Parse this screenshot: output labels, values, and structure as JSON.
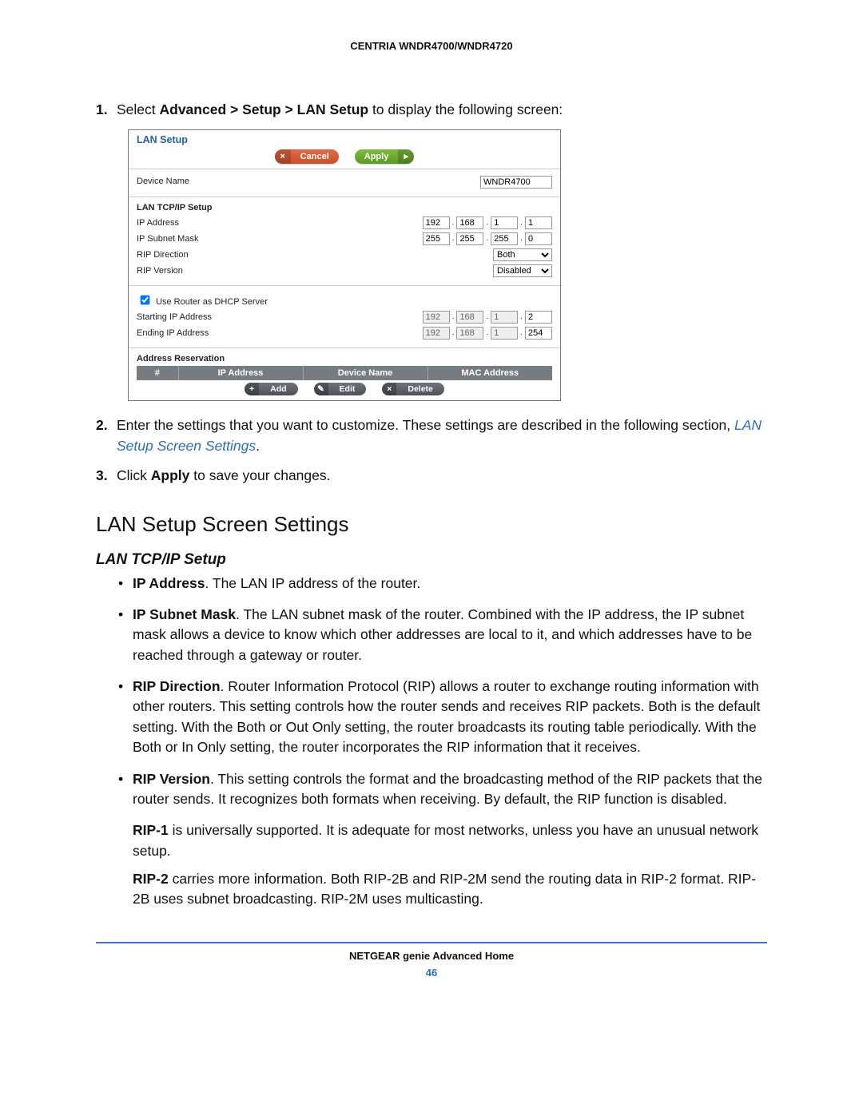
{
  "doc_header": "CENTRIA WNDR4700/WNDR4720",
  "step1": {
    "num": "1.",
    "pre": "Select ",
    "path": "Advanced > Setup > LAN Setup",
    "post": " to display the following screen:"
  },
  "panel": {
    "title": "LAN Setup",
    "cancel": "Cancel",
    "apply": "Apply",
    "cancel_icon": "×",
    "apply_icon": "▸",
    "device_name_lbl": "Device Name",
    "device_name_val": "WNDR4700",
    "tcpip_header": "LAN TCP/IP Setup",
    "ip_addr_lbl": "IP Address",
    "ip_addr": [
      "192",
      "168",
      "1",
      "1"
    ],
    "subnet_lbl": "IP Subnet Mask",
    "subnet": [
      "255",
      "255",
      "255",
      "0"
    ],
    "rip_dir_lbl": "RIP Direction",
    "rip_dir_val": "Both",
    "rip_ver_lbl": "RIP Version",
    "rip_ver_val": "Disabled",
    "dhcp_lbl": "Use Router as DHCP Server",
    "start_lbl": "Starting IP Address",
    "start": [
      "192",
      "168",
      "1",
      "2"
    ],
    "end_lbl": "Ending IP Address",
    "end": [
      "192",
      "168",
      "1",
      "254"
    ],
    "res_header": "Address Reservation",
    "cols": {
      "num": "#",
      "ip": "IP Address",
      "dev": "Device Name",
      "mac": "MAC Address"
    },
    "btn_add": "Add",
    "btn_edit": "Edit",
    "btn_del": "Delete",
    "plus": "+",
    "pencil": "✎",
    "x": "×"
  },
  "step2": {
    "num": "2.",
    "pre": "Enter the settings that you want to customize. These settings are described in the following section, ",
    "link": "LAN Setup Screen Settings",
    "post": "."
  },
  "step3": {
    "num": "3.",
    "pre": "Click ",
    "bold": "Apply",
    "post": " to save your changes."
  },
  "h2": "LAN Setup Screen Settings",
  "h3": "LAN TCP/IP Setup",
  "bul": {
    "ip_b": "IP Address",
    "ip_t": ". The LAN IP address of the router.",
    "sm_b": "IP Subnet Mask",
    "sm_t": ". The LAN subnet mask of the router. Combined with the IP address, the IP subnet mask allows a device to know which other addresses are local to it, and which addresses have to be reached through a gateway or router.",
    "rd_b": "RIP Direction",
    "rd_t": ". Router Information Protocol (RIP) allows a router to exchange routing information with other routers. This setting controls how the router sends and receives RIP packets. Both is the default setting. With the Both or Out Only setting, the router broadcasts its routing table periodically. With the Both or In Only setting, the router incorporates the RIP information that it receives.",
    "rv_b": "RIP Version",
    "rv_t": ". This setting controls the format and the broadcasting method of the RIP packets that the router sends. It recognizes both formats when receiving. By default, the RIP function is disabled."
  },
  "rip1": {
    "b": "RIP-1",
    "t": " is universally supported. It is adequate for most networks, unless you have an unusual network setup."
  },
  "rip2": {
    "b": "RIP-2",
    "t": " carries more information. Both RIP-2B and RIP-2M send the routing data in RIP-2 format. RIP-2B uses subnet broadcasting. RIP-2M uses multicasting."
  },
  "footer_title": "NETGEAR genie Advanced Home",
  "footer_page": "46"
}
